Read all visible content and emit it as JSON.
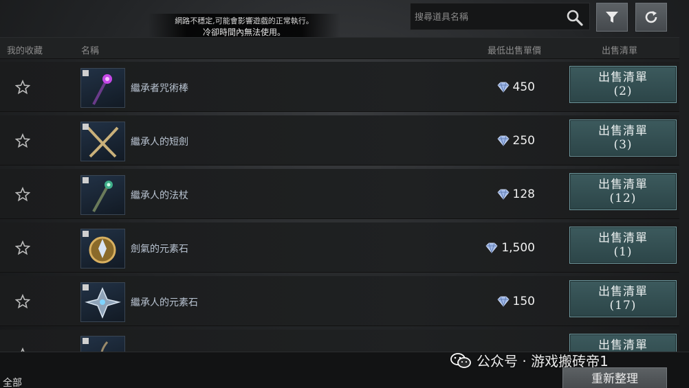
{
  "notice": {
    "line1": "網路不穩定,可能會影響遊戲的正常執行。",
    "line2": "冷卻時間內無法使用。"
  },
  "search": {
    "placeholder": "搜尋道具名稱"
  },
  "toolbar": {
    "filter_icon": "filter-icon",
    "refresh_icon": "refresh-icon"
  },
  "columns": {
    "favorite": "我的收藏",
    "name": "名稱",
    "lowest_price": "最低出售單價",
    "listings": "出售清單"
  },
  "items": [
    {
      "name": "繼承者咒術棒",
      "price": "450",
      "button_label": "出售清單",
      "count": "(2)",
      "icon": "staff-purple-icon"
    },
    {
      "name": "繼承人的短劍",
      "price": "250",
      "button_label": "出售清單",
      "count": "(3)",
      "icon": "crossed-daggers-icon"
    },
    {
      "name": "繼承人的法杖",
      "price": "128",
      "button_label": "出售清單",
      "count": "(12)",
      "icon": "staff-green-icon"
    },
    {
      "name": "劍氣的元素石",
      "price": "1,500",
      "button_label": "出售清單",
      "count": "(1)",
      "icon": "element-stone-gold-icon"
    },
    {
      "name": "繼承人的元素石",
      "price": "150",
      "button_label": "出售清單",
      "count": "(17)",
      "icon": "element-stone-star-icon"
    },
    {
      "name": "",
      "price": "",
      "button_label": "出售清單",
      "count": "",
      "icon": "partial-item-icon"
    }
  ],
  "footer": {
    "all_label": "全部",
    "sort_button": "重新整理"
  },
  "watermark": {
    "text": "公众号 · 游戏搬砖帝1"
  },
  "colors": {
    "sell_button": "#3c5a5d",
    "diamond": "#9fb8e8"
  }
}
